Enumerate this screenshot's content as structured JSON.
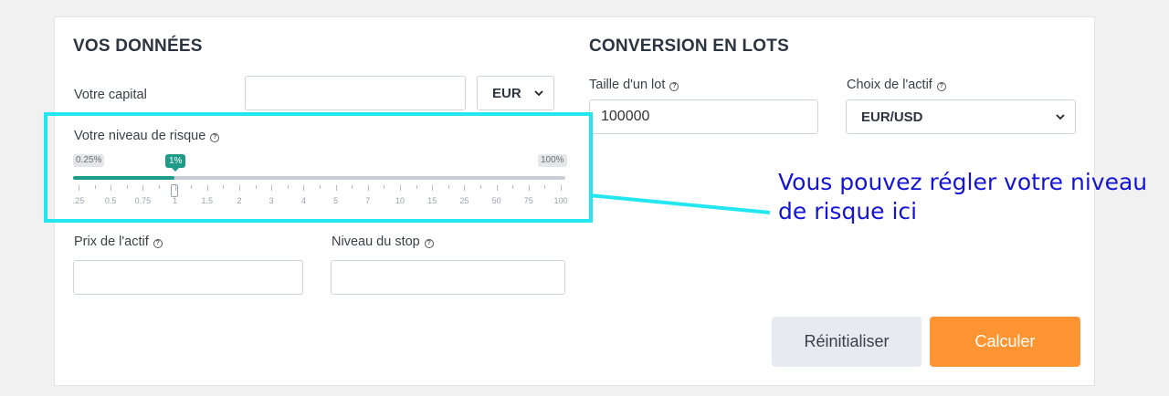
{
  "left": {
    "title": "VOS DONNÉES",
    "capital_label": "Votre capital",
    "capital_value": "",
    "currency_selected": "EUR",
    "risk_label": "Votre niveau de risque",
    "risk_min_badge": "0.25%",
    "risk_max_badge": "100%",
    "risk_current_badge": "1%",
    "risk_ticks": [
      ".25",
      "0.5",
      "0.75",
      "1",
      "1.5",
      "2",
      "3",
      "4",
      "5",
      "7",
      "10",
      "15",
      "25",
      "50",
      "75",
      "100"
    ],
    "asset_price_label": "Prix de l'actif",
    "asset_price_value": "",
    "stop_label": "Niveau du stop",
    "stop_value": ""
  },
  "right": {
    "title": "CONVERSION EN LOTS",
    "lot_size_label": "Taille d'un lot",
    "lot_size_value": "100000",
    "asset_choice_label": "Choix de l'actif",
    "asset_choice_selected": "EUR/USD"
  },
  "buttons": {
    "reset_label": "Réinitialiser",
    "calculate_label": "Calculer"
  },
  "annotation": {
    "line1": "Vous pouvez régler votre niveau",
    "line2": "de risque ici"
  },
  "colors": {
    "accent": "#1f9b8a",
    "calculate": "#ff9532",
    "highlight": "#22e7f0",
    "annotation": "#1414d6"
  }
}
